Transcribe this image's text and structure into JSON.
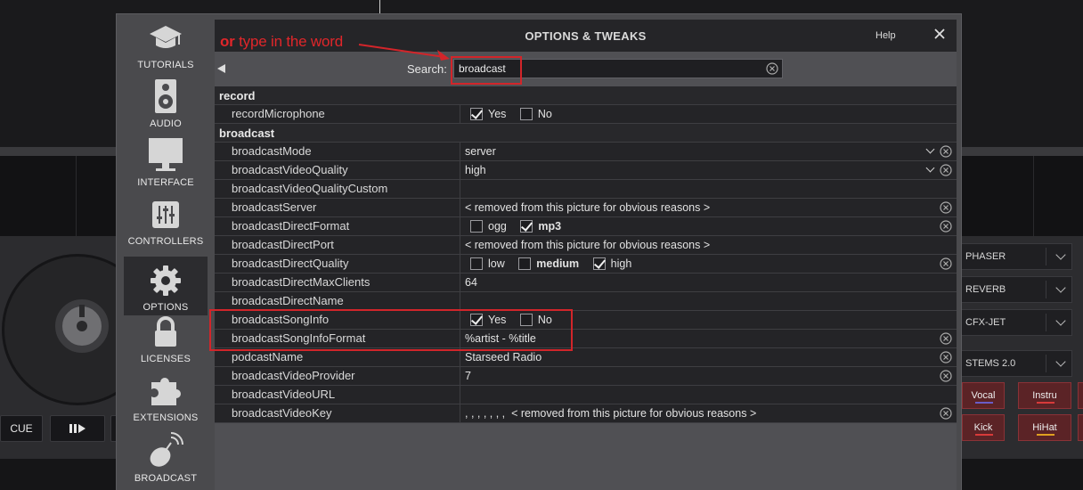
{
  "modal": {
    "title": "OPTIONS & TWEAKS",
    "help_label": "Help",
    "annotation_or": "or",
    "annotation_rest": " type in the word",
    "search": {
      "label": "Search:",
      "value": "broadcast"
    }
  },
  "sidebar": {
    "items": [
      {
        "label": "TUTORIALS",
        "icon": "graduation-cap-icon"
      },
      {
        "label": "AUDIO",
        "icon": "speaker-icon"
      },
      {
        "label": "INTERFACE",
        "icon": "monitor-icon"
      },
      {
        "label": "CONTROLLERS",
        "icon": "sliders-icon"
      },
      {
        "label": "OPTIONS",
        "icon": "gear-icon",
        "active": true
      },
      {
        "label": "LICENSES",
        "icon": "lock-icon"
      },
      {
        "label": "EXTENSIONS",
        "icon": "puzzle-icon"
      },
      {
        "label": "BROADCAST",
        "icon": "satellite-dish-icon"
      }
    ]
  },
  "settings": {
    "record_section": "record",
    "broadcast_section": "broadcast",
    "recordMicrophone": {
      "key": "recordMicrophone",
      "yes": "Yes",
      "no": "No",
      "checked": "yes"
    },
    "broadcastMode": {
      "key": "broadcastMode",
      "value": "server"
    },
    "broadcastVideoQuality": {
      "key": "broadcastVideoQuality",
      "value": "high"
    },
    "broadcastVideoQualityCustom": {
      "key": "broadcastVideoQualityCustom",
      "value": ""
    },
    "broadcastServer": {
      "key": "broadcastServer",
      "value": "< removed from this picture for obvious reasons >"
    },
    "broadcastDirectFormat": {
      "key": "broadcastDirectFormat",
      "opt1": "ogg",
      "opt2": "mp3",
      "checked": "mp3"
    },
    "broadcastDirectPort": {
      "key": "broadcastDirectPort",
      "value": "< removed from this picture for obvious reasons >"
    },
    "broadcastDirectQuality": {
      "key": "broadcastDirectQuality",
      "opt1": "low",
      "opt2": "medium",
      "opt3": "high",
      "checked": "high"
    },
    "broadcastDirectMaxClients": {
      "key": "broadcastDirectMaxClients",
      "value": "64"
    },
    "broadcastDirectName": {
      "key": "broadcastDirectName",
      "value": ""
    },
    "broadcastSongInfo": {
      "key": "broadcastSongInfo",
      "yes": "Yes",
      "no": "No",
      "checked": "yes"
    },
    "broadcastSongInfoFormat": {
      "key": "broadcastSongInfoFormat",
      "value": "%artist - %title"
    },
    "podcastName": {
      "key": "podcastName",
      "value": "Starseed Radio"
    },
    "broadcastVideoProvider": {
      "key": "broadcastVideoProvider",
      "value": "7"
    },
    "broadcastVideoURL": {
      "key": "broadcastVideoURL",
      "value": ""
    },
    "broadcastVideoKey": {
      "key": "broadcastVideoKey",
      "prefix": ", , , , , , ,",
      "value": "< removed from this picture for obvious reasons >"
    }
  },
  "deck": {
    "cue_label": "CUE",
    "effects": [
      "PHASER",
      "REVERB",
      "CFX-JET"
    ],
    "stems_label": "STEMS 2.0",
    "stem_pads": [
      "Vocal",
      "Instru",
      "Kick",
      "HiHat"
    ]
  },
  "colors": {
    "annotation_red": "#d2252a",
    "panel_bg": "#505054",
    "row_bg": "#242427",
    "stem_pad": "#5b2326"
  }
}
